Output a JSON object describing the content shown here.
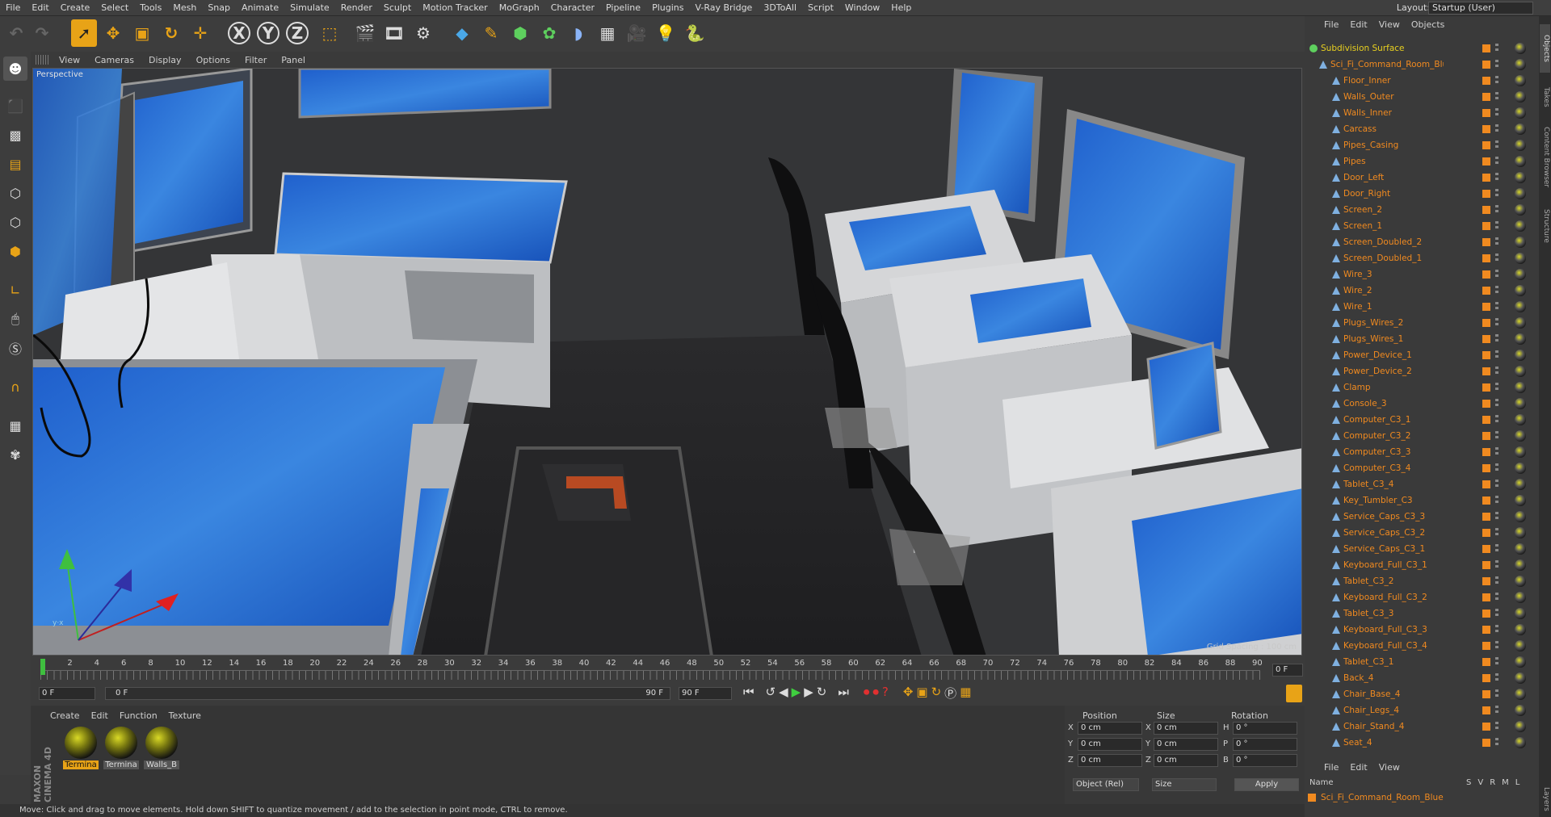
{
  "menubar": {
    "items": [
      "File",
      "Edit",
      "Create",
      "Select",
      "Tools",
      "Mesh",
      "Snap",
      "Animate",
      "Simulate",
      "Render",
      "Sculpt",
      "Motion Tracker",
      "MoGraph",
      "Character",
      "Pipeline",
      "Plugins",
      "V-Ray Bridge",
      "3DToAll",
      "Script",
      "Window",
      "Help"
    ],
    "layout_label": "Layout:",
    "layout_value": "Startup (User)"
  },
  "viewport": {
    "menu": [
      "View",
      "Cameras",
      "Display",
      "Options",
      "Filter",
      "Panel"
    ],
    "camera_label": "Perspective",
    "grid_spacing": "Grid Spacing : 100 cm"
  },
  "timeline": {
    "ticks": [
      "0",
      "2",
      "4",
      "6",
      "8",
      "10",
      "12",
      "14",
      "16",
      "18",
      "20",
      "22",
      "24",
      "26",
      "28",
      "30",
      "32",
      "34",
      "36",
      "38",
      "40",
      "42",
      "44",
      "46",
      "48",
      "50",
      "52",
      "54",
      "56",
      "58",
      "60",
      "62",
      "64",
      "66",
      "68",
      "70",
      "72",
      "74",
      "76",
      "78",
      "80",
      "82",
      "84",
      "86",
      "88",
      "90"
    ],
    "current_frame": "0 F",
    "start_field": "0 F",
    "range_start": "0 F",
    "range_end": "90 F",
    "end_field": "90 F"
  },
  "material_manager": {
    "menu": [
      "Create",
      "Edit",
      "Function",
      "Texture"
    ],
    "materials": [
      "Termina",
      "Termina",
      "Walls_B"
    ],
    "brand": "MAXON CINEMA 4D"
  },
  "coordinates": {
    "headers": [
      "Position",
      "Size",
      "Rotation"
    ],
    "rows": [
      {
        "axis": "X",
        "pos": "0 cm",
        "size_axis": "X",
        "size": "0 cm",
        "rot_axis": "H",
        "rot": "0 °"
      },
      {
        "axis": "Y",
        "pos": "0 cm",
        "size_axis": "Y",
        "size": "0 cm",
        "rot_axis": "P",
        "rot": "0 °"
      },
      {
        "axis": "Z",
        "pos": "0 cm",
        "size_axis": "Z",
        "size": "0 cm",
        "rot_axis": "B",
        "rot": "0 °"
      }
    ],
    "mode_select": "Object (Rel)",
    "size_select": "Size",
    "apply_label": "Apply"
  },
  "object_manager": {
    "menu": [
      "File",
      "Edit",
      "View",
      "Objects"
    ],
    "root": "Subdivision Surface",
    "group": "Sci_Fi_Command_Room_Blue",
    "objects": [
      "Floor_Inner",
      "Walls_Outer",
      "Walls_Inner",
      "Carcass",
      "Pipes_Casing",
      "Pipes",
      "Door_Left",
      "Door_Right",
      "Screen_2",
      "Screen_1",
      "Screen_Doubled_2",
      "Screen_Doubled_1",
      "Wire_3",
      "Wire_2",
      "Wire_1",
      "Plugs_Wires_2",
      "Plugs_Wires_1",
      "Power_Device_1",
      "Power_Device_2",
      "Clamp",
      "Console_3",
      "Computer_C3_1",
      "Computer_C3_2",
      "Computer_C3_3",
      "Computer_C3_4",
      "Tablet_C3_4",
      "Key_Tumbler_C3",
      "Service_Caps_C3_3",
      "Service_Caps_C3_2",
      "Service_Caps_C3_1",
      "Keyboard_Full_C3_1",
      "Tablet_C3_2",
      "Keyboard_Full_C3_2",
      "Tablet_C3_3",
      "Keyboard_Full_C3_3",
      "Keyboard_Full_C3_4",
      "Tablet_C3_1",
      "Back_4",
      "Chair_Base_4",
      "Chair_Legs_4",
      "Chair_Stand_4",
      "Seat_4"
    ]
  },
  "layer_manager": {
    "menu": [
      "File",
      "Edit",
      "View"
    ],
    "name_header": "Name",
    "col_headers": [
      "S",
      "V",
      "R",
      "M",
      "L"
    ],
    "layer": "Sci_Fi_Command_Room_Blue"
  },
  "right_tabs": [
    "Objects",
    "Takes",
    "Content Browser",
    "Structure",
    "Layers"
  ],
  "status": "Move: Click and drag to move elements. Hold down SHIFT to quantize movement / add to the selection in point mode, CTRL to remove.",
  "colors": {
    "accent": "#f08a20",
    "selection": "#e8a317",
    "screen": "#2a6fd0"
  }
}
